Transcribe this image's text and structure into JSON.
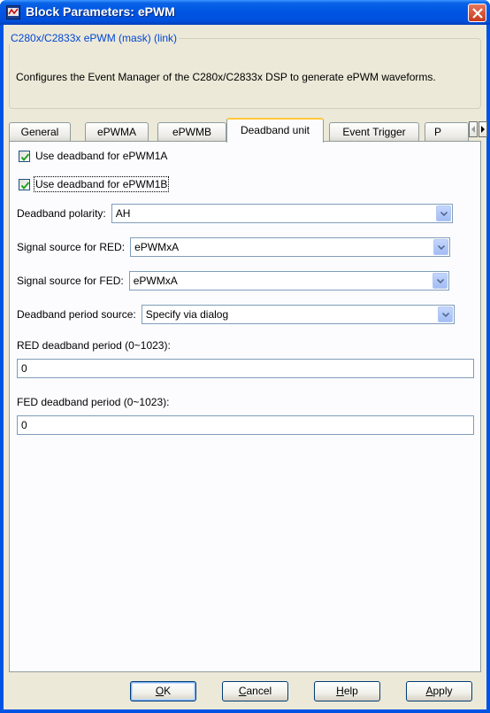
{
  "window": {
    "title": "Block Parameters: ePWM"
  },
  "description": {
    "group_title": "C280x/C2833x ePWM (mask) (link)",
    "text": "Configures the Event Manager of the C280x/C2833x DSP to generate ePWM waveforms."
  },
  "tabs": [
    {
      "label": "General"
    },
    {
      "label": "ePWMA"
    },
    {
      "label": "ePWMB"
    },
    {
      "label": "Deadband unit",
      "active": true
    },
    {
      "label": "Event Trigger"
    },
    {
      "label": "P"
    }
  ],
  "panel": {
    "cb_1a": {
      "label": "Use deadband for ePWM1A",
      "checked": true
    },
    "cb_1b": {
      "label": "Use deadband for ePWM1B",
      "checked": true
    },
    "polarity": {
      "label": "Deadband polarity:",
      "value": "AH"
    },
    "red_source": {
      "label": "Signal source for RED:",
      "value": "ePWMxA"
    },
    "fed_source": {
      "label": "Signal source for FED:",
      "value": "ePWMxA"
    },
    "period_source": {
      "label": "Deadband period source:",
      "value": "Specify via dialog"
    },
    "red_period": {
      "label": "RED deadband period (0~1023):",
      "value": "0"
    },
    "fed_period": {
      "label": "FED deadband period (0~1023):",
      "value": "0"
    }
  },
  "buttons": {
    "ok": {
      "underlined": "O",
      "rest": "K"
    },
    "cancel": {
      "underlined": "C",
      "rest": "ancel"
    },
    "help": {
      "underlined": "H",
      "rest": "elp"
    },
    "apply": {
      "underlined": "A",
      "rest": "pply"
    }
  },
  "colors": {
    "titlebar": "#0054e3",
    "dialog_bg": "#ece9d8",
    "legend_text": "#0046d5",
    "active_tab_accent": "#ffc83c"
  },
  "icons": {
    "app": "simulink-block-icon",
    "close": "close-icon",
    "dropdown": "chevron-down-icon",
    "check": "check-icon",
    "tab_scroll_left": "arrow-left-icon",
    "tab_scroll_right": "arrow-right-icon"
  }
}
